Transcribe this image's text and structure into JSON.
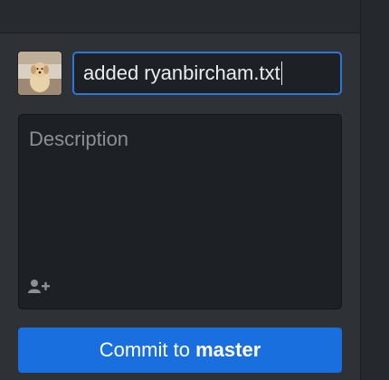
{
  "commit_form": {
    "summary_value": "added ryanbircham.txt",
    "description_placeholder": "Description",
    "button_prefix": "Commit to ",
    "button_branch": "master"
  },
  "icons": {
    "avatar": "user-avatar-photo",
    "coauthor": "add-coauthor-icon"
  },
  "colors": {
    "accent": "#1a6fde",
    "focus_border": "#2d76d6",
    "panel_bg": "#2e3237",
    "input_bg": "#1d2024"
  }
}
